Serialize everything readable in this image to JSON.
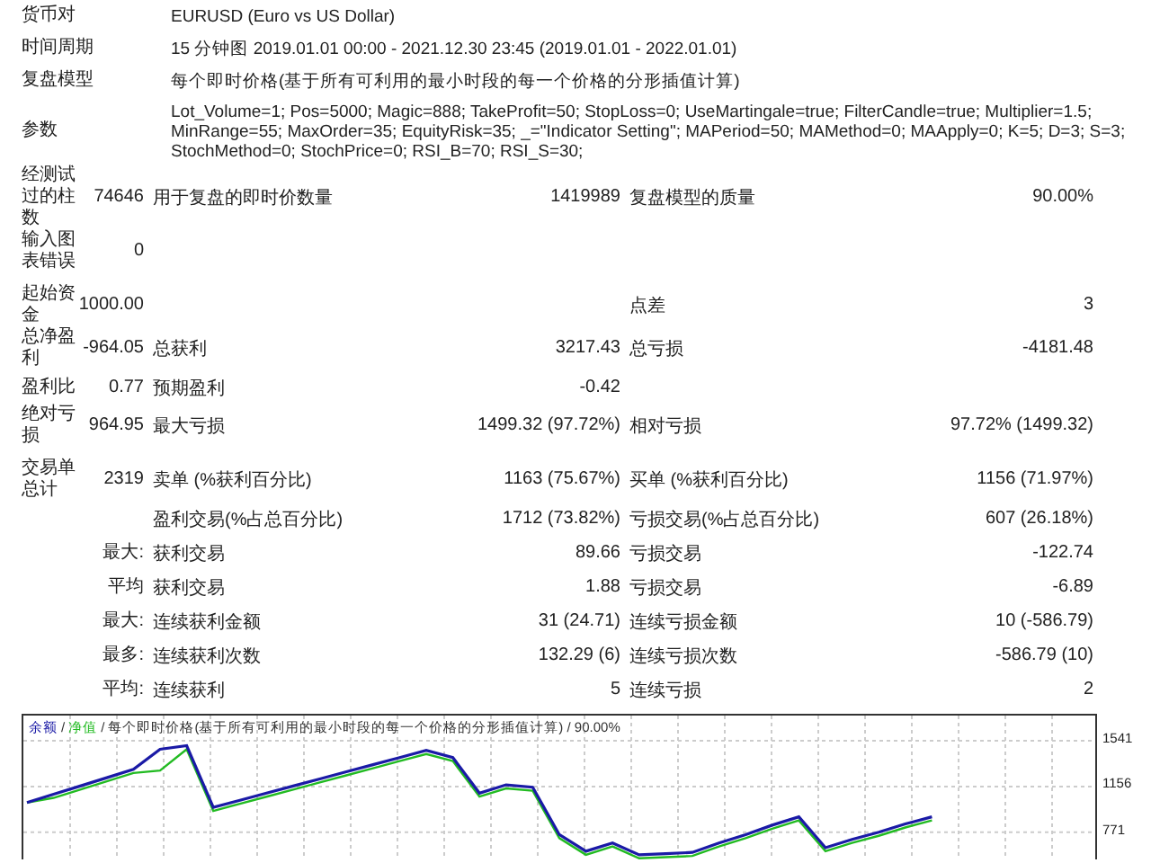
{
  "info": [
    {
      "label": "货币对",
      "lines": [
        "EURUSD (Euro vs US Dollar)"
      ]
    },
    {
      "label": "时间周期",
      "lines": [
        "15 分钟图 2019.01.01 00:00 - 2021.12.30 23:45 (2019.01.01 - 2022.01.01)"
      ]
    },
    {
      "label": "复盘模型",
      "lines": [
        "每个即时价格(基于所有可利用的最小时段的每一个价格的分形插值计算)"
      ]
    },
    {
      "label": "参数",
      "lines": [
        "Lot_Volume=1; Pos=5000; Magic=888; TakeProfit=50; StopLoss=0; UseMartingale=true; FilterCandle=true; Multiplier=1.5;",
        "MinRange=55; MaxOrder=35; EquityRisk=35; _=\"Indicator Setting\"; MAPeriod=50; MAMethod=0; MAApply=0; K=5; D=3; S=3;",
        "StochMethod=0; StochPrice=0; RSI_B=70; RSI_S=30;"
      ]
    }
  ],
  "stats": [
    {
      "label": "经测试过的柱数",
      "value": "74646",
      "cells": [
        {
          "label": "用于复盘的即时价数量",
          "value": "1419989"
        },
        {
          "label": "复盘模型的质量",
          "value": "90.00%"
        }
      ]
    },
    {
      "label": "输入图表错误",
      "value": "0"
    },
    {
      "label": "起始资金",
      "value": "1000.00",
      "cells": [
        {},
        {
          "label": "点差",
          "value": "3"
        }
      ]
    },
    {
      "label": "总净盈利",
      "value": "-964.05",
      "cells": [
        {
          "label": "总获利",
          "value": "3217.43"
        },
        {
          "label": "总亏损",
          "value": "-4181.48"
        }
      ]
    },
    {
      "label": "盈利比",
      "value": "0.77",
      "cells": [
        {
          "label": "预期盈利",
          "value": "-0.42"
        }
      ]
    },
    {
      "label": "绝对亏损",
      "value": "964.95",
      "cells": [
        {
          "label": "最大亏损",
          "value": "1499.32 (97.72%)"
        },
        {
          "label": "相对亏损",
          "value": "97.72% (1499.32)"
        }
      ]
    },
    {
      "label": "交易单总计",
      "value": "2319",
      "cells": [
        {
          "label": "卖单 (%获利百分比)",
          "value": "1163 (75.67%)"
        },
        {
          "label": "买单 (%获利百分比)",
          "value": "1156 (71.97%)"
        }
      ]
    },
    {
      "cells": [
        {
          "label": "盈利交易(%占总百分比)",
          "value": "1712 (73.82%)"
        },
        {
          "label": "亏损交易(%占总百分比)",
          "value": "607 (26.18%)"
        }
      ]
    },
    {
      "value": "最大:",
      "cells": [
        {
          "label": "获利交易",
          "value": "89.66"
        },
        {
          "label": "亏损交易",
          "value": "-122.74"
        }
      ]
    },
    {
      "value": "平均",
      "cells": [
        {
          "label": "获利交易",
          "value": "1.88"
        },
        {
          "label": "亏损交易",
          "value": "-6.89"
        }
      ]
    },
    {
      "value": "最大:",
      "cells": [
        {
          "label": "连续获利金额",
          "value": "31 (24.71)"
        },
        {
          "label": "连续亏损金额",
          "value": "10 (-586.79)"
        }
      ]
    },
    {
      "value": "最多:",
      "cells": [
        {
          "label": "连续获利次数",
          "value": "132.29 (6)"
        },
        {
          "label": "连续亏损次数",
          "value": "-586.79 (10)"
        }
      ]
    },
    {
      "value": "平均:",
      "cells": [
        {
          "label": "连续获利",
          "value": "5"
        },
        {
          "label": "连续亏损",
          "value": "2"
        }
      ]
    }
  ],
  "chart": {
    "legend_separator": "/",
    "chart_data": {
      "type": "line",
      "title": "每个即时价格(基于所有可利用的最小时段的每一个价格的分形插值计算) / 90.00%",
      "grid": true,
      "ylim": [
        541,
        1754
      ],
      "yticks": [
        {
          "value": 771,
          "label": "771"
        },
        {
          "value": 1156,
          "label": "1156"
        },
        {
          "value": 1541,
          "label": "1541"
        }
      ],
      "series": [
        {
          "name": "余额",
          "color": "#1a1aa6",
          "values": [
            1020,
            1090,
            1160,
            1230,
            1300,
            1470,
            1500,
            980,
            1040,
            1100,
            1160,
            1220,
            1280,
            1340,
            1400,
            1460,
            1400,
            1100,
            1170,
            1150,
            750,
            610,
            680,
            580,
            590,
            600,
            680,
            750,
            830,
            900,
            640,
            710,
            770,
            840,
            900,
            null,
            null,
            null,
            null,
            null,
            null
          ]
        },
        {
          "name": "净值",
          "color": "#22bb22",
          "values": [
            1020,
            1060,
            1130,
            1200,
            1270,
            1290,
            1470,
            950,
            1010,
            1070,
            1130,
            1190,
            1250,
            1310,
            1370,
            1430,
            1370,
            1070,
            1140,
            1120,
            720,
            580,
            650,
            550,
            560,
            570,
            650,
            720,
            800,
            870,
            610,
            680,
            740,
            810,
            870,
            null,
            null,
            null,
            null,
            null,
            null
          ]
        }
      ]
    }
  }
}
